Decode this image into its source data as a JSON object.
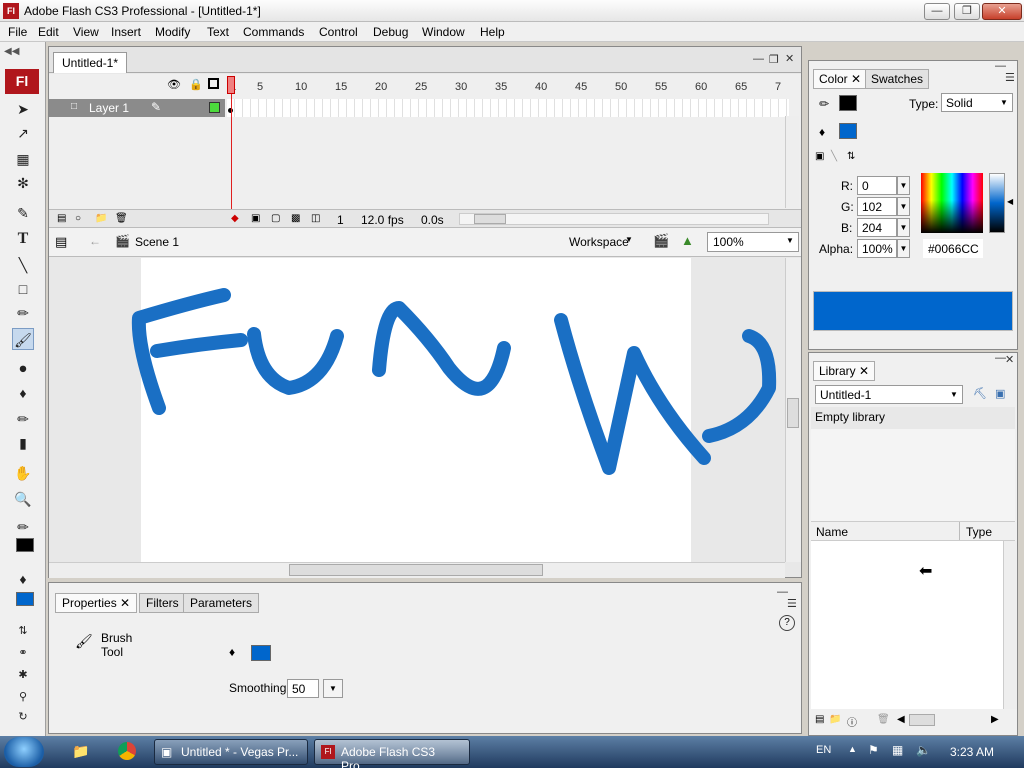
{
  "window": {
    "logo_text": "Fl",
    "title": "Adobe Flash CS3 Professional - [Untitled-1*]"
  },
  "menu": [
    "File",
    "Edit",
    "View",
    "Insert",
    "Modify",
    "Text",
    "Commands",
    "Control",
    "Debug",
    "Window",
    "Help"
  ],
  "toolbar": {
    "logo": "Fl"
  },
  "document": {
    "tab_label": "Untitled-1*",
    "timeline": {
      "layer_name": "Layer 1",
      "ruler_ticks": [
        "1",
        "5",
        "10",
        "15",
        "20",
        "25",
        "30",
        "35",
        "40",
        "45",
        "50",
        "55",
        "60",
        "65",
        "7"
      ],
      "current_frame": "1",
      "frame_rate": "12.0 fps",
      "elapsed_time": "0.0s"
    },
    "scene_label": "Scene 1",
    "workspace_label": "Workspace",
    "zoom": "100%",
    "stage_drawing_color": "#1a6fc4"
  },
  "properties": {
    "tabs": [
      "Properties",
      "Filters",
      "Parameters"
    ],
    "tool_name_line1": "Brush",
    "tool_name_line2": "Tool",
    "smoothing_label": "Smoothing",
    "smoothing_value": "50",
    "fill_color": "#0066CC"
  },
  "color_panel": {
    "tabs": [
      "Color",
      "Swatches"
    ],
    "type_label": "Type:",
    "type_value": "Solid",
    "r_label": "R:",
    "r_value": "0",
    "g_label": "G:",
    "g_value": "102",
    "b_label": "B:",
    "b_value": "204",
    "alpha_label": "Alpha:",
    "alpha_value": "100%",
    "hex_value": "#0066CC",
    "preview_color": "#0066CC"
  },
  "library_panel": {
    "tab": "Library",
    "document_select": "Untitled-1",
    "empty_text": "Empty library",
    "col_name": "Name",
    "col_type": "Type"
  },
  "taskbar": {
    "items": [
      {
        "label": "Untitled * - Vegas Pr..."
      },
      {
        "label": "Adobe Flash CS3 Pro..."
      }
    ],
    "language": "EN",
    "clock": "3:23 AM"
  }
}
